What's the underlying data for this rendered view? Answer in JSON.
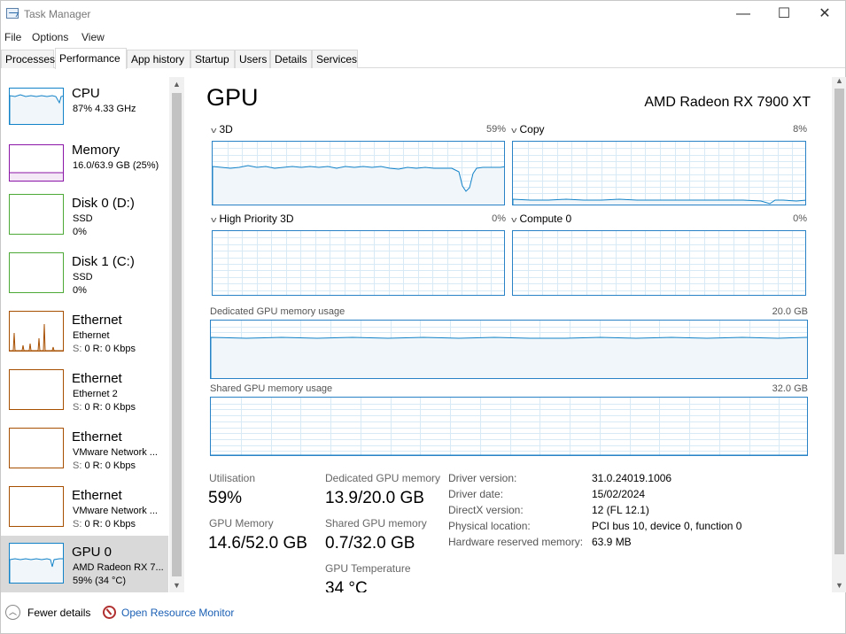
{
  "window": {
    "title": "Task Manager",
    "minimize": "—",
    "maximize": "☐",
    "close": "✕"
  },
  "menu": [
    "File",
    "Options",
    "View"
  ],
  "tabs": [
    "Processes",
    "Performance",
    "App history",
    "Startup",
    "Users",
    "Details",
    "Services"
  ],
  "active_tab": "Performance",
  "sidebar": {
    "items": [
      {
        "name": "CPU",
        "line2": "87% 4.33 GHz",
        "line3": "",
        "color": "#1182c8",
        "selected": false
      },
      {
        "name": "Memory",
        "line2": "16.0/63.9 GB (25%)",
        "line3": "",
        "color": "#8b15a6",
        "selected": false
      },
      {
        "name": "Disk 0 (D:)",
        "line2": "SSD",
        "line3": "0%",
        "color": "#4da935",
        "selected": false
      },
      {
        "name": "Disk 1 (C:)",
        "line2": "SSD",
        "line3": "0%",
        "color": "#4da935",
        "selected": false
      },
      {
        "name": "Ethernet",
        "line2": "Ethernet",
        "line3_s": "S:",
        "line3": "0 R: 0 Kbps",
        "color": "#a74f01",
        "selected": false
      },
      {
        "name": "Ethernet",
        "line2": "Ethernet 2",
        "line3_s": "S:",
        "line3": "0 R: 0 Kbps",
        "color": "#a74f01",
        "selected": false
      },
      {
        "name": "Ethernet",
        "line2": "VMware Network ...",
        "line3_s": "S:",
        "line3": "0 R: 0 Kbps",
        "color": "#a74f01",
        "selected": false
      },
      {
        "name": "Ethernet",
        "line2": "VMware Network ...",
        "line3_s": "S:",
        "line3": "0 R: 0 Kbps",
        "color": "#a74f01",
        "selected": false
      },
      {
        "name": "GPU 0",
        "line2": "AMD Radeon RX 7...",
        "line3": "59% (34 °C)",
        "color": "#1182c8",
        "selected": true
      }
    ]
  },
  "main": {
    "title": "GPU",
    "model": "AMD Radeon RX 7900 XT",
    "engines": [
      {
        "label": "3D",
        "percent": "59%"
      },
      {
        "label": "Copy",
        "percent": "8%"
      },
      {
        "label": "High Priority 3D",
        "percent": "0%"
      },
      {
        "label": "Compute 0",
        "percent": "0%"
      }
    ],
    "dedicated_label": "Dedicated GPU memory usage",
    "dedicated_max": "20.0 GB",
    "shared_label": "Shared GPU memory usage",
    "shared_max": "32.0 GB",
    "stats": {
      "utilisation_label": "Utilisation",
      "utilisation_value": "59%",
      "gpu_memory_label": "GPU Memory",
      "gpu_memory_value": "14.6/52.0 GB",
      "dedicated_label": "Dedicated GPU memory",
      "dedicated_value": "13.9/20.0 GB",
      "shared_label": "Shared GPU memory",
      "shared_value": "0.7/32.0 GB",
      "temp_label": "GPU Temperature",
      "temp_value": "34 °C"
    },
    "info": [
      {
        "label": "Driver version:",
        "value": "31.0.24019.1006"
      },
      {
        "label": "Driver date:",
        "value": "15/02/2024"
      },
      {
        "label": "DirectX version:",
        "value": "12 (FL 12.1)"
      },
      {
        "label": "Physical location:",
        "value": "PCI bus 10, device 0, function 0"
      },
      {
        "label": "Hardware reserved memory:",
        "value": "63.9 MB"
      }
    ]
  },
  "footer": {
    "fewer_details": "Fewer details",
    "open_monitor": "Open Resource Monitor"
  },
  "colors": {
    "gpu_line": "#1182c8",
    "gpu_fill": "#f1f6fa",
    "grid": "#d9eaf7",
    "link": "#1a5fb4"
  }
}
